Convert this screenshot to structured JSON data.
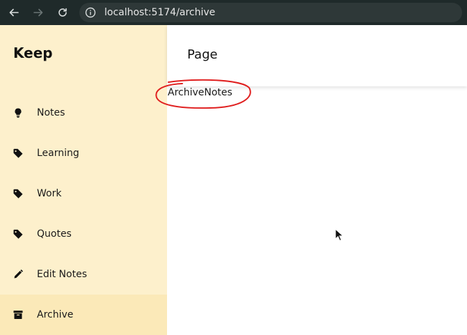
{
  "browser": {
    "url": "localhost:5174/archive",
    "icons": [
      "back-arrow-icon",
      "forward-arrow-icon",
      "reload-icon",
      "info-icon"
    ]
  },
  "sidebar": {
    "brand": "Keep",
    "items": [
      {
        "label": "Notes",
        "icon": "lightbulb-icon"
      },
      {
        "label": "Learning",
        "icon": "tag-icon"
      },
      {
        "label": "Work",
        "icon": "tag-icon"
      },
      {
        "label": "Quotes",
        "icon": "tag-icon"
      },
      {
        "label": "Edit Notes",
        "icon": "pencil-icon"
      },
      {
        "label": "Archive",
        "icon": "archive-icon"
      }
    ]
  },
  "header": {
    "title": "Page"
  },
  "main": {
    "content": "ArchiveNotes"
  },
  "colors": {
    "sidebar_bg": "#fdf0cc",
    "toolbar_bg": "#1f2a2a",
    "annotation": "#e02020"
  }
}
